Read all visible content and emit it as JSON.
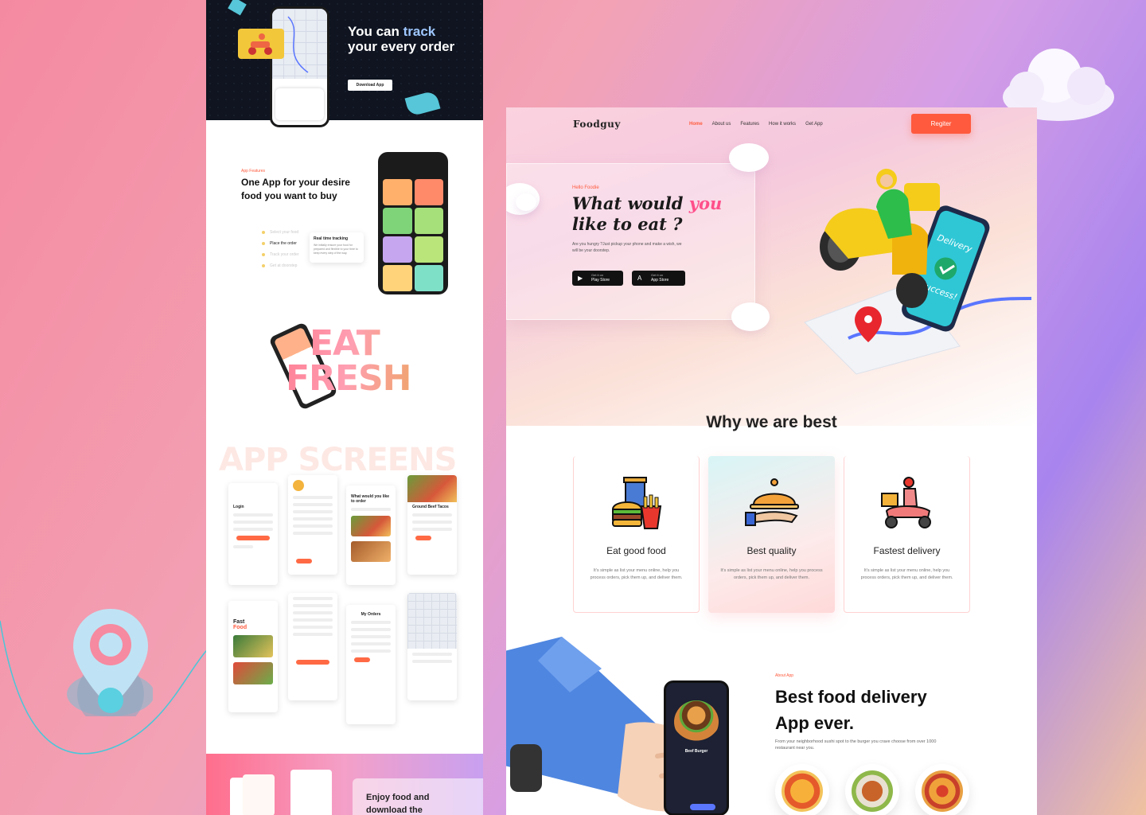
{
  "left_mockup": {
    "hero": {
      "title_part1": "You can ",
      "title_highlight": "track",
      "title_part2": "your every order",
      "button": "Download App"
    },
    "features": {
      "tag": "App Features",
      "title": "One App for your desire food you want to buy",
      "steps": [
        "Select your food",
        "Place the order",
        "Track your order",
        "Get at doorstep"
      ],
      "active_step_index": 1,
      "tracking_title": "Real time tracking",
      "tracking_desc": "We initially ensure your food for prepared and flexible to your time to keep every step of the way."
    },
    "eat_fresh": {
      "line1": "EAT",
      "line2": "FRESH"
    },
    "app_screens_title": "APP SCREENS",
    "screens": {
      "login": "Login",
      "what_would_you_like": "What would you like to order",
      "ground_beef": "Ground Beef Tacos",
      "fast_food_1": "Fast",
      "fast_food_2": "Food",
      "my_orders": "My Orders"
    },
    "bottom": {
      "text": "Enjoy food and download the"
    }
  },
  "right_mockup": {
    "header": {
      "logo": "Foodguy",
      "nav": [
        "Home",
        "About us",
        "Features",
        "How it works",
        "Get App"
      ],
      "active_nav_index": 0,
      "register": "Regiter"
    },
    "hero": {
      "hello": "Hello Foodie",
      "title_part1": "What would ",
      "title_highlight": "you",
      "title_part2": "like to eat ?",
      "description": "Are you hungry ?Just pickup your phone and make a wish, we will be your doorstep.",
      "play_store_small": "Get it on",
      "play_store": "Play Store",
      "app_store_small": "Get it on",
      "app_store": "App Store"
    },
    "phone_screen": {
      "line1": "Delivery",
      "line2": "Success!"
    },
    "why_title": "Why we are best",
    "features": [
      {
        "icon": "fast-food-icon",
        "title": "Eat good food",
        "desc": "It's simple as list your menu online, help you process orders, pick them up, and deliver them."
      },
      {
        "icon": "cloche-icon",
        "title": "Best quality",
        "desc": "It's simple as list your menu online, help you process orders, pick them up, and deliver them."
      },
      {
        "icon": "delivery-scooter-icon",
        "title": "Fastest delivery",
        "desc": "It's simple as list your menu online, help you process orders, pick them up, and deliver them."
      }
    ],
    "highlighted_feature_index": 1,
    "about": {
      "tag": "About App",
      "title": "Best food delivery App ever.",
      "desc": "From your neighborhood sushi spot to the burger you crave choose from over 1000 restaurant near you.",
      "phone_item": "Beef Burger"
    }
  },
  "colors": {
    "accent": "#ff5a3d",
    "pink": "#ff4f8a",
    "dark": "#0f1420",
    "teal": "#56c6d8"
  }
}
